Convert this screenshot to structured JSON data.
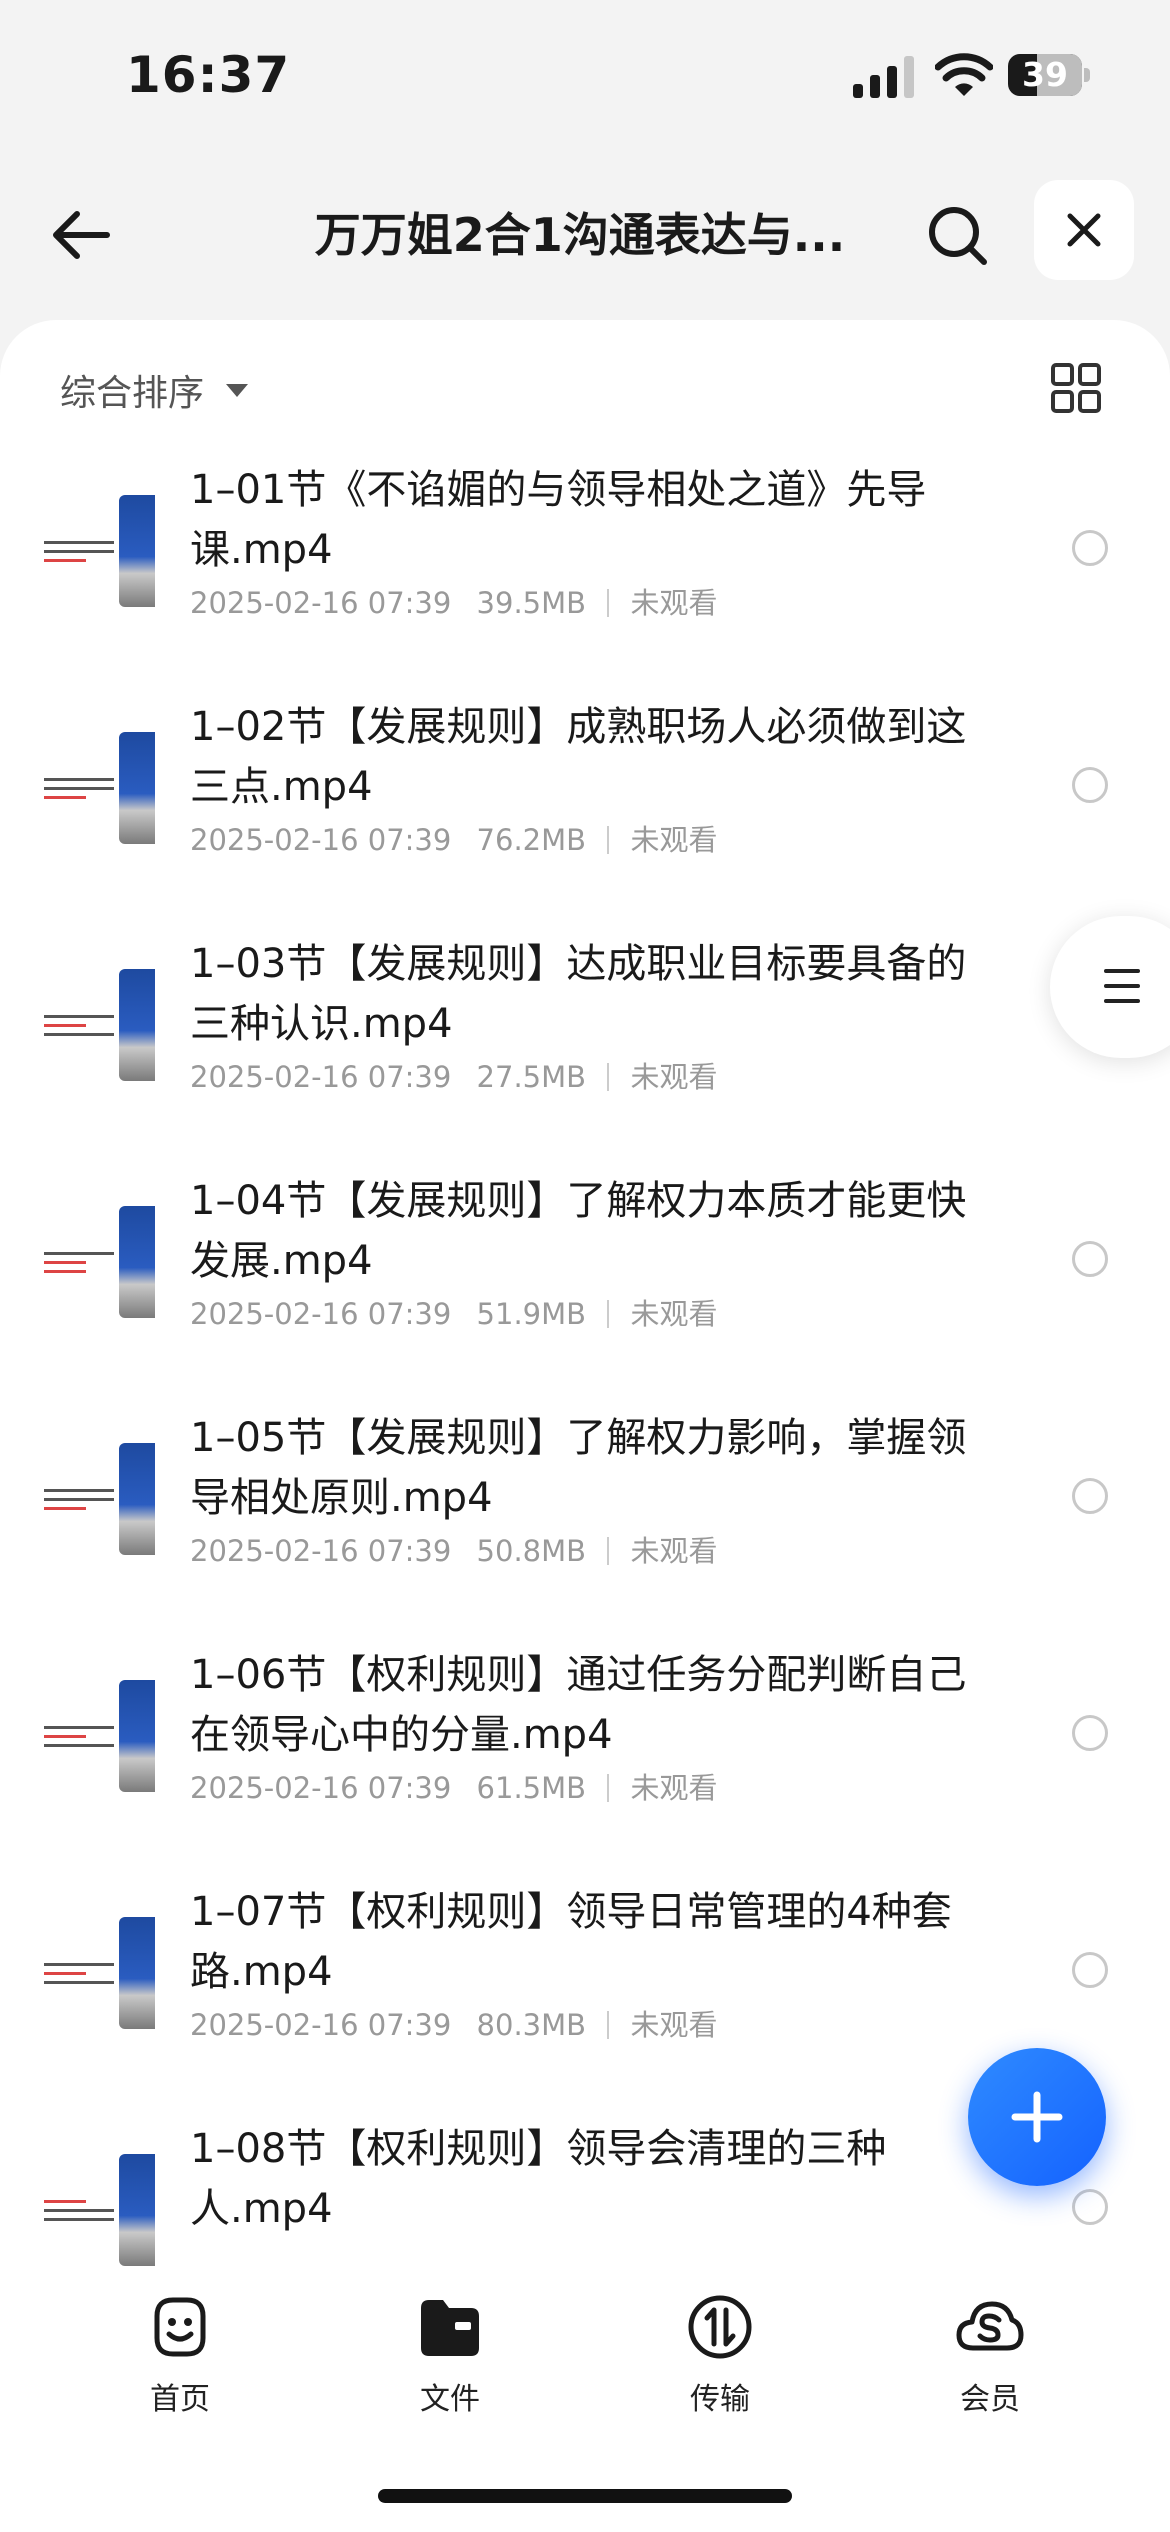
{
  "status": {
    "time": "16:37",
    "battery": "39",
    "battery_level": 0.39
  },
  "header": {
    "title": "万万姐2合1沟通表达与..."
  },
  "toolbar": {
    "sort_label": "综合排序"
  },
  "files": [
    {
      "name": "1–01节《不谄媚的与领导相处之道》先导课.mp4",
      "date": "2025-02-16 07:39",
      "size": "39.5MB",
      "status": "未观看"
    },
    {
      "name": "1–02节【发展规则】成熟职场人必须做到这三点.mp4",
      "date": "2025-02-16 07:39",
      "size": "76.2MB",
      "status": "未观看"
    },
    {
      "name": "1–03节【发展规则】达成职业目标要具备的三种认识.mp4",
      "date": "2025-02-16 07:39",
      "size": "27.5MB",
      "status": "未观看"
    },
    {
      "name": "1–04节【发展规则】了解权力本质才能更快发展.mp4",
      "date": "2025-02-16 07:39",
      "size": "51.9MB",
      "status": "未观看"
    },
    {
      "name": "1–05节【发展规则】了解权力影响，掌握领导相处原则.mp4",
      "date": "2025-02-16 07:39",
      "size": "50.8MB",
      "status": "未观看"
    },
    {
      "name": "1–06节【权利规则】通过任务分配判断自己在领导心中的分量.mp4",
      "date": "2025-02-16 07:39",
      "size": "61.5MB",
      "status": "未观看"
    },
    {
      "name": "1–07节【权利规则】领导日常管理的4种套路.mp4",
      "date": "2025-02-16 07:39",
      "size": "80.3MB",
      "status": "未观看"
    },
    {
      "name": "1–08节【权利规则】领导会清理的三种人.mp4",
      "date": "",
      "size": "",
      "status": ""
    }
  ],
  "tabs": [
    {
      "label": "首页",
      "icon": "smile-face-icon"
    },
    {
      "label": "文件",
      "icon": "folder-icon"
    },
    {
      "label": "传输",
      "icon": "transfer-icon"
    },
    {
      "label": "会员",
      "icon": "cloud-s-icon"
    }
  ]
}
